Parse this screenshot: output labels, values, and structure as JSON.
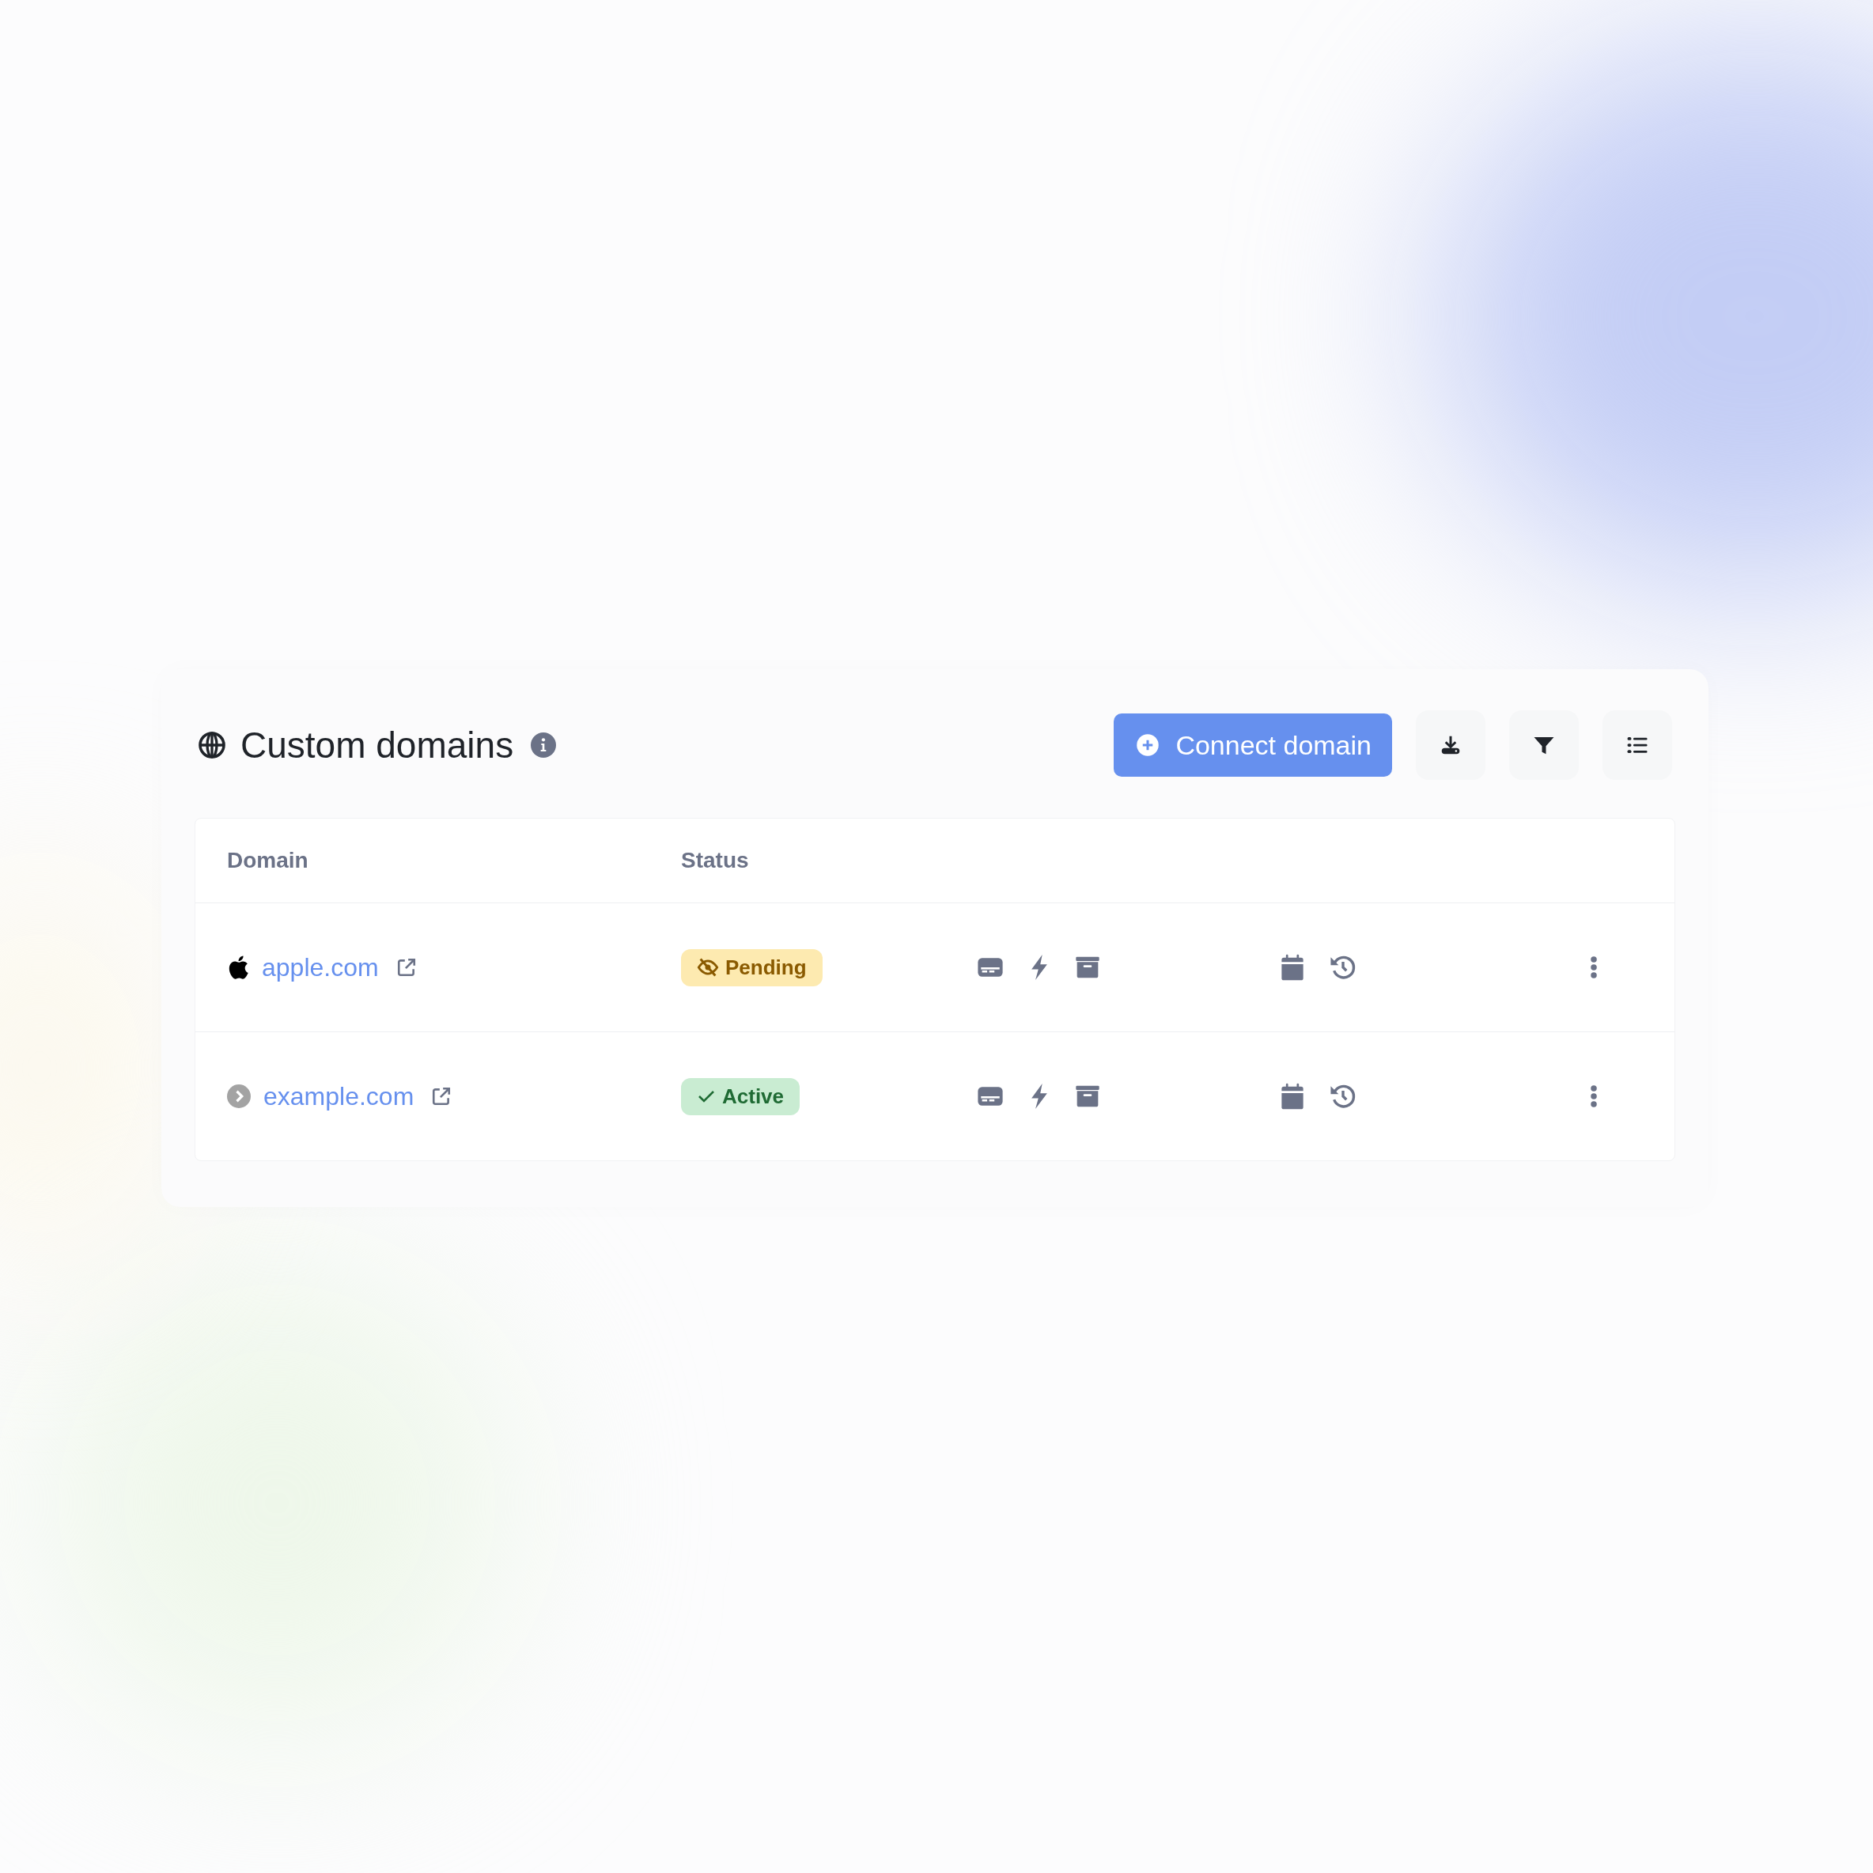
{
  "header": {
    "title": "Custom domains",
    "primary_button": "Connect domain"
  },
  "table": {
    "columns": [
      "Domain",
      "Status"
    ],
    "rows": [
      {
        "domain": "apple.com",
        "kind": "logo",
        "status": {
          "label": "Pending",
          "kind": "pending"
        }
      },
      {
        "domain": "example.com",
        "kind": "default",
        "status": {
          "label": "Active",
          "kind": "active"
        }
      }
    ]
  }
}
